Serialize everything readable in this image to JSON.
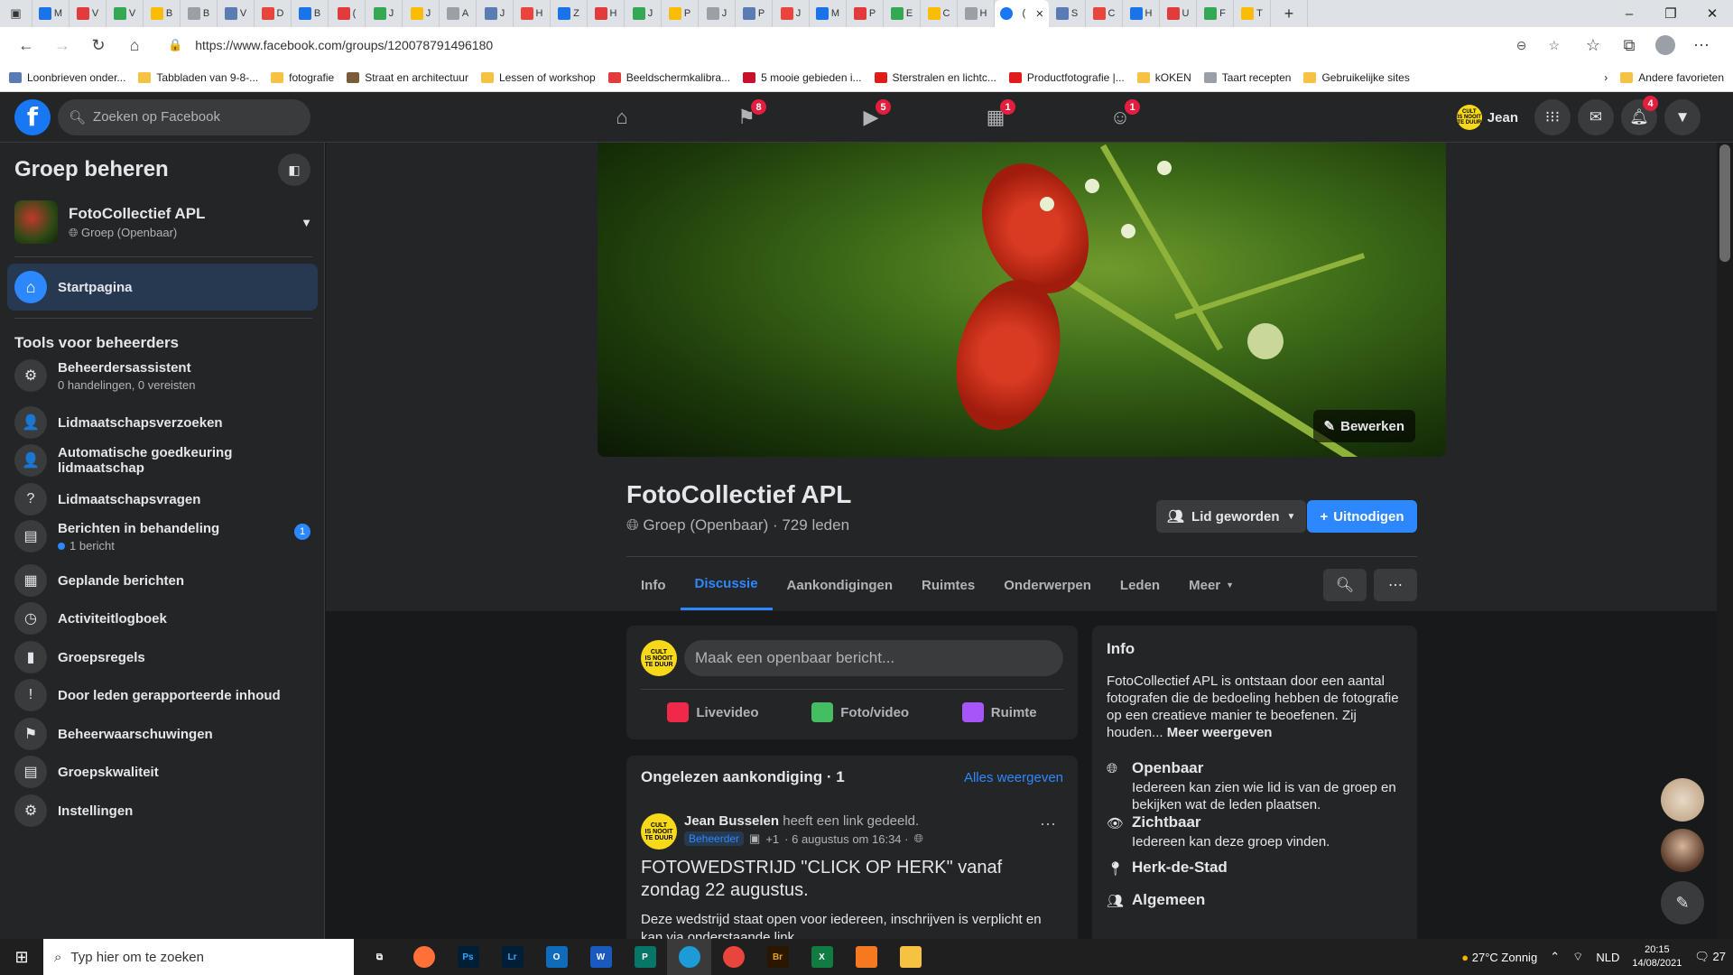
{
  "browser": {
    "active_tab_label": "(",
    "url": "https://www.facebook.com/groups/120078791496180",
    "bookmarks": [
      {
        "label": "Loonbrieven onder...",
        "color": "#5b7bb5"
      },
      {
        "label": "Tabbladen van 9-8-...",
        "color": "#f5c242"
      },
      {
        "label": "fotografie",
        "color": "#f5c242"
      },
      {
        "label": "Straat en architectuur",
        "color": "#7a5c3a"
      },
      {
        "label": "Lessen of workshop",
        "color": "#f5c242"
      },
      {
        "label": "Beeldschermkalibra...",
        "color": "#e23b3b"
      },
      {
        "label": "5 mooie gebieden i...",
        "color": "#c8102e"
      },
      {
        "label": "Sterstralen en lichtc...",
        "color": "#e21b1b"
      },
      {
        "label": "Productfotografie |...",
        "color": "#e21b1b"
      },
      {
        "label": "kOKEN",
        "color": "#f5c242"
      },
      {
        "label": "Taart recepten",
        "color": "#9aa0a6"
      },
      {
        "label": "Gebruikelijke sites",
        "color": "#f5c242"
      }
    ],
    "other_bookmarks": "Andere favorieten",
    "tab_letters": [
      "M",
      "V",
      "V",
      "B",
      "B",
      "V",
      "D",
      "B",
      "(",
      "J",
      "J",
      "A",
      "J",
      "H",
      "Z",
      "H",
      "J",
      "P",
      "J",
      "P",
      "J",
      "M",
      "P",
      "E",
      "C",
      "H",
      "S",
      "C",
      "H",
      "U",
      "F",
      "T"
    ]
  },
  "facebook": {
    "search_placeholder": "Zoeken op Facebook",
    "nav_badges": [
      "8",
      "5",
      "1",
      "1"
    ],
    "profile_name": "Jean",
    "notif_badge": "4"
  },
  "sidebar": {
    "title": "Groep beheren",
    "group_name": "FotoCollectief APL",
    "group_type": "Groep (Openbaar)",
    "home_label": "Startpagina",
    "tools_heading": "Tools voor beheerders",
    "items": [
      {
        "label": "Beheerdersassistent",
        "sub": "0 handelingen, 0 vereisten",
        "icon": "robot-icon"
      },
      {
        "label": "Lidmaatschapsverzoeken",
        "sub": "",
        "icon": "person-add-icon"
      },
      {
        "label": "Automatische goedkeuring lidmaatschap",
        "sub": "",
        "icon": "person-check-icon"
      },
      {
        "label": "Lidmaatschapsvragen",
        "sub": "",
        "icon": "person-question-icon"
      },
      {
        "label": "Berichten in behandeling",
        "sub": "1 bericht",
        "icon": "pending-posts-icon",
        "count": "1"
      },
      {
        "label": "Geplande berichten",
        "sub": "",
        "icon": "calendar-icon"
      },
      {
        "label": "Activiteitlogboek",
        "sub": "",
        "icon": "clock-icon"
      },
      {
        "label": "Groepsregels",
        "sub": "",
        "icon": "book-icon"
      },
      {
        "label": "Door leden gerapporteerde inhoud",
        "sub": "",
        "icon": "report-icon"
      },
      {
        "label": "Beheerwaarschuwingen",
        "sub": "",
        "icon": "alert-icon"
      },
      {
        "label": "Groepskwaliteit",
        "sub": "",
        "icon": "quality-icon"
      },
      {
        "label": "Instellingen",
        "sub": "",
        "icon": "gear-icon"
      }
    ]
  },
  "group": {
    "title": "FotoCollectief APL",
    "meta": "Groep (Openbaar) · 729 leden",
    "edit_cover": "Bewerken",
    "joined_btn": "Lid geworden",
    "invite_btn": "Uitnodigen",
    "tabs": [
      "Info",
      "Discussie",
      "Aankondigingen",
      "Ruimtes",
      "Onderwerpen",
      "Leden",
      "Meer"
    ]
  },
  "composer": {
    "placeholder": "Maak een openbaar bericht...",
    "actions": [
      {
        "label": "Livevideo",
        "color": "#f02849"
      },
      {
        "label": "Foto/video",
        "color": "#45bd62"
      },
      {
        "label": "Ruimte",
        "color": "#a855f7"
      }
    ]
  },
  "announcement": {
    "heading": "Ongelezen aankondiging · 1",
    "view_all": "Alles weergeven",
    "author": "Jean Busselen",
    "action": "heeft een link gedeeld.",
    "role": "Beheerder",
    "plus": "+1",
    "date": "· 6 augustus om 16:34 ·",
    "title_upper": "FOTOWEDSTRIJD \"CLICK OP HERK\"",
    "title_rest": "vanaf zondag 22 augustus.",
    "body": "Deze wedstrijd staat open voor iedereen, inschrijven is verplicht en kan via onderstaande link"
  },
  "info": {
    "heading": "Info",
    "desc": "FotoCollectief APL is ontstaan door een aantal fotografen die de bedoeling hebben de fotografie op een creatieve manier te beoefenen. Zij houden...",
    "more": "Meer weergeven",
    "rows": [
      {
        "title": "Openbaar",
        "desc": "Iedereen kan zien wie lid is van de groep en bekijken wat de leden plaatsen.",
        "icon": "globe-icon"
      },
      {
        "title": "Zichtbaar",
        "desc": "Iedereen kan deze groep vinden.",
        "icon": "eye-icon"
      },
      {
        "title": "Herk-de-Stad",
        "desc": "",
        "icon": "location-icon"
      },
      {
        "title": "Algemeen",
        "desc": "",
        "icon": "people-icon"
      }
    ]
  },
  "avatar_text": "CULTUUR IS NOOIT TE DUUR",
  "taskbar": {
    "search_placeholder": "Typ hier om te zoeken",
    "weather": "27°C  Zonnig",
    "lang": "NLD",
    "time": "20:15",
    "date": "14/08/2021",
    "notif_count": "27"
  }
}
